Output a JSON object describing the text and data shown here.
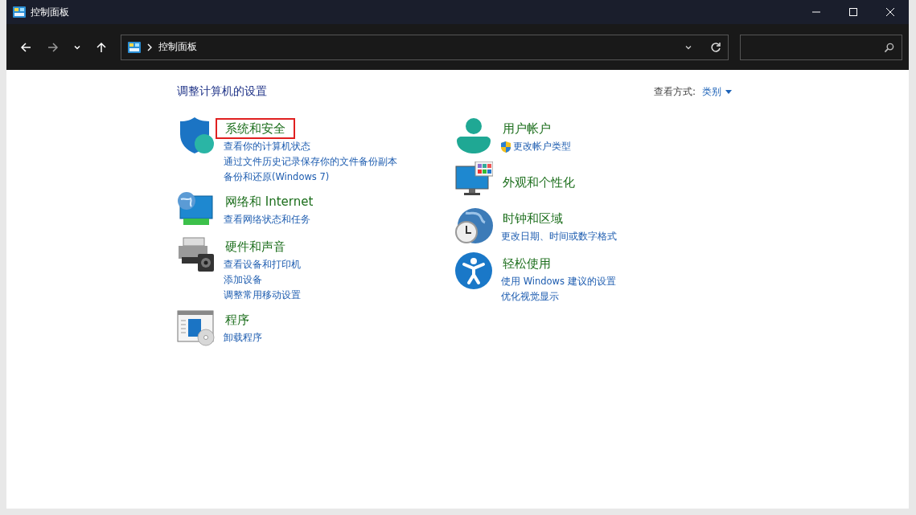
{
  "window": {
    "title": "控制面板"
  },
  "address_bar": {
    "path": "控制面板"
  },
  "heading": "调整计算机的设置",
  "view_by": {
    "label": "查看方式:",
    "value": "类别"
  },
  "columns": [
    {
      "categories": [
        {
          "kind": "security",
          "title": "系统和安全",
          "highlighted": true,
          "links": [
            {
              "text": "查看你的计算机状态",
              "shield": false
            },
            {
              "text": "通过文件历史记录保存你的文件备份副本",
              "shield": false
            },
            {
              "text": "备份和还原(Windows 7)",
              "shield": false
            }
          ]
        },
        {
          "kind": "network",
          "title": "网络和 Internet",
          "highlighted": false,
          "links": [
            {
              "text": "查看网络状态和任务",
              "shield": false
            }
          ]
        },
        {
          "kind": "hardware",
          "title": "硬件和声音",
          "highlighted": false,
          "links": [
            {
              "text": "查看设备和打印机",
              "shield": false
            },
            {
              "text": "添加设备",
              "shield": false
            },
            {
              "text": "调整常用移动设置",
              "shield": false
            }
          ]
        },
        {
          "kind": "programs",
          "title": "程序",
          "highlighted": false,
          "links": [
            {
              "text": "卸载程序",
              "shield": false
            }
          ]
        }
      ]
    },
    {
      "categories": [
        {
          "kind": "user",
          "title": "用户帐户",
          "highlighted": false,
          "links": [
            {
              "text": "更改帐户类型",
              "shield": true
            }
          ]
        },
        {
          "kind": "appearance",
          "title": "外观和个性化",
          "highlighted": false
        },
        {
          "kind": "clock",
          "title": "时钟和区域",
          "highlighted": false,
          "links": [
            {
              "text": "更改日期、时间或数字格式",
              "shield": false
            }
          ]
        },
        {
          "kind": "ease",
          "title": "轻松使用",
          "highlighted": false,
          "links": [
            {
              "text": "使用 Windows 建议的设置",
              "shield": false
            },
            {
              "text": "优化视觉显示",
              "shield": false
            }
          ]
        }
      ]
    }
  ]
}
